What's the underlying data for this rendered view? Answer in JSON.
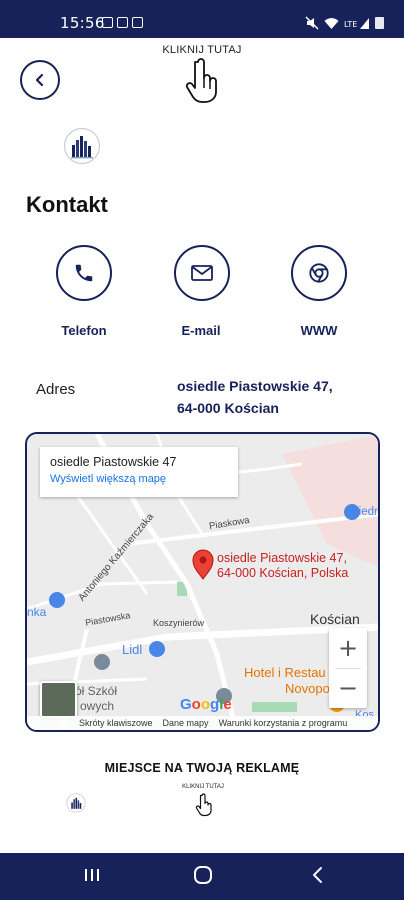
{
  "status_bar": {
    "time": "15:56"
  },
  "header": {
    "hint": "KLIKNIJ TUTAJ"
  },
  "page": {
    "title": "Kontakt"
  },
  "contact": {
    "phone_label": "Telefon",
    "email_label": "E-mail",
    "www_label": "WWW"
  },
  "address": {
    "label": "Adres",
    "line1": "osiedle Piastowskie 47,",
    "line2": "64-000 Kościan"
  },
  "map": {
    "card_title": "osiedle Piastowskie 47",
    "card_link": "Wyświetl większą mapę",
    "pin_line1": "osiedle Piastowskie 47,",
    "pin_line2": "64-000 Kościan, Polska",
    "labels": {
      "biedronka": "Biedronka",
      "piaskowa": "Piaskowa",
      "kazmierczaka": "Antoniego Kaźmierczaka",
      "koszy": "Koszynierów",
      "piastowska": "Piastowska",
      "koscian": "Kościan",
      "lidl": "Lidl",
      "hotel1": "Hotel i Restau",
      "hotel2": "Novopo",
      "szkol1": "ół Szkół",
      "szkol2": "owych",
      "nka": "nka",
      "kos": "Kos"
    },
    "google": "Google",
    "footer": [
      "Skróty klawiszowe",
      "Dane mapy",
      "Warunki korzystania z programu"
    ]
  },
  "promo": {
    "text": "MIEJSCE NA TWOJĄ REKLAMĘ",
    "hint": "KLIKNIJ TUTAJ"
  }
}
